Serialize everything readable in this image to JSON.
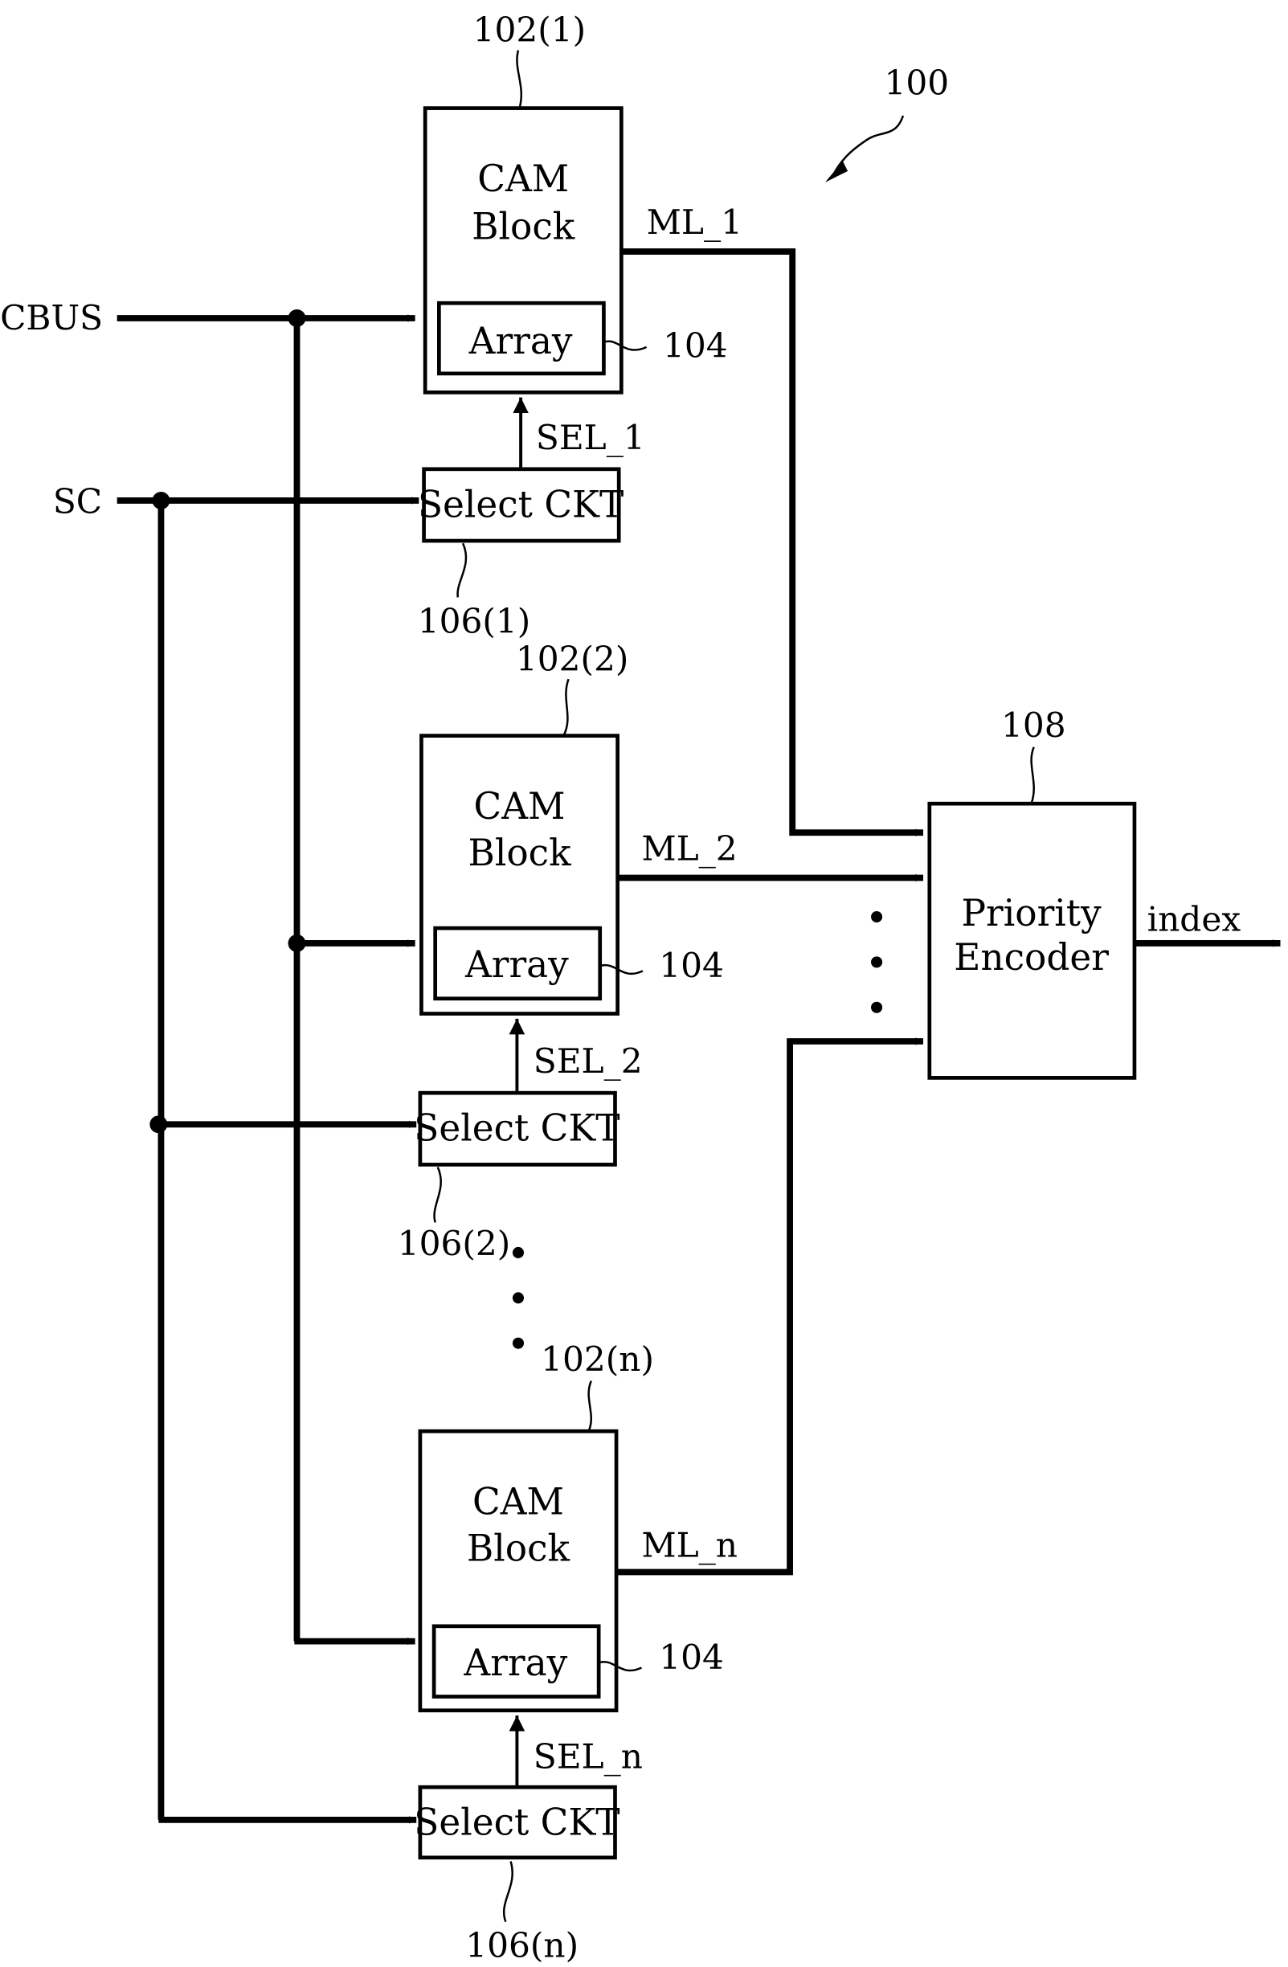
{
  "figure": {
    "reference": "100",
    "inputs": {
      "cbus": "CBUS",
      "sc": "SC"
    },
    "cam_blocks": [
      {
        "ref": "102(1)",
        "line1": "CAM",
        "line2": "Block",
        "array_label": "Array",
        "array_ref": "104",
        "match_line": "ML_1",
        "select_signal": "SEL_1",
        "select_label": "Select CKT",
        "select_ref": "106(1)"
      },
      {
        "ref": "102(2)",
        "line1": "CAM",
        "line2": "Block",
        "array_label": "Array",
        "array_ref": "104",
        "match_line": "ML_2",
        "select_signal": "SEL_2",
        "select_label": "Select CKT",
        "select_ref": "106(2)"
      },
      {
        "ref": "102(n)",
        "line1": "CAM",
        "line2": "Block",
        "array_label": "Array",
        "array_ref": "104",
        "match_line": "ML_n",
        "select_signal": "SEL_n",
        "select_label": "Select CKT",
        "select_ref": "106(n)"
      }
    ],
    "encoder": {
      "ref": "108",
      "line1": "Priority",
      "line2": "Encoder",
      "output": "index"
    }
  }
}
